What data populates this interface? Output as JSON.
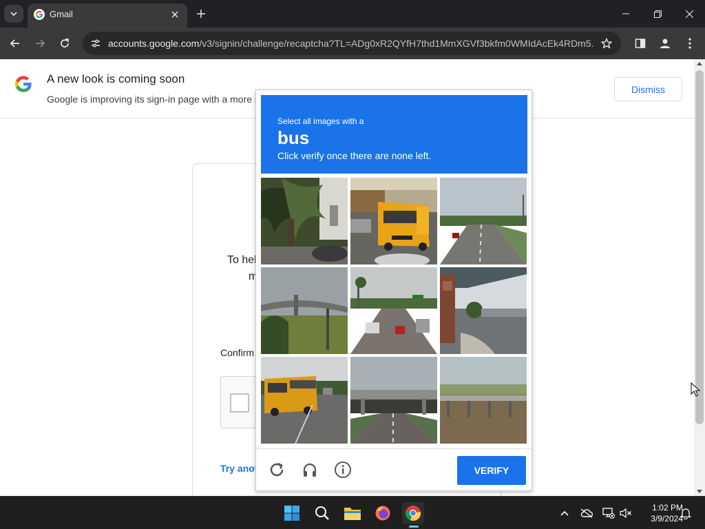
{
  "browser": {
    "tab_title": "Gmail",
    "url_host": "accounts.google.com",
    "url_path": "/v3/signin/challenge/recaptcha?TL=ADg0xR2QYfH7thd1MmXGVf3bkfm0WMIdAcEk4RDm5..."
  },
  "banner": {
    "title": "A new look is coming soon",
    "text": "Google is improving its sign-in page with a more r",
    "dismiss_label": "Dismiss"
  },
  "signin": {
    "help_line1": "To hel",
    "help_line2": "m",
    "confirm_label": "Confirm",
    "try_link": "Try anot"
  },
  "captcha": {
    "instruction_line1": "Select all images with a",
    "target_word": "bus",
    "instruction_line2": "Click verify once there are none left.",
    "verify_label": "VERIFY",
    "tiles": [
      "palm-tree-street",
      "school-bus",
      "highway",
      "overpass",
      "street-traffic",
      "parking-lot-sign",
      "school-bus-street",
      "highway-overpass",
      "bridge-over-water"
    ],
    "accent_color": "#1a73e8"
  },
  "taskbar": {
    "time": "1:02 PM",
    "date": "3/9/2024"
  }
}
